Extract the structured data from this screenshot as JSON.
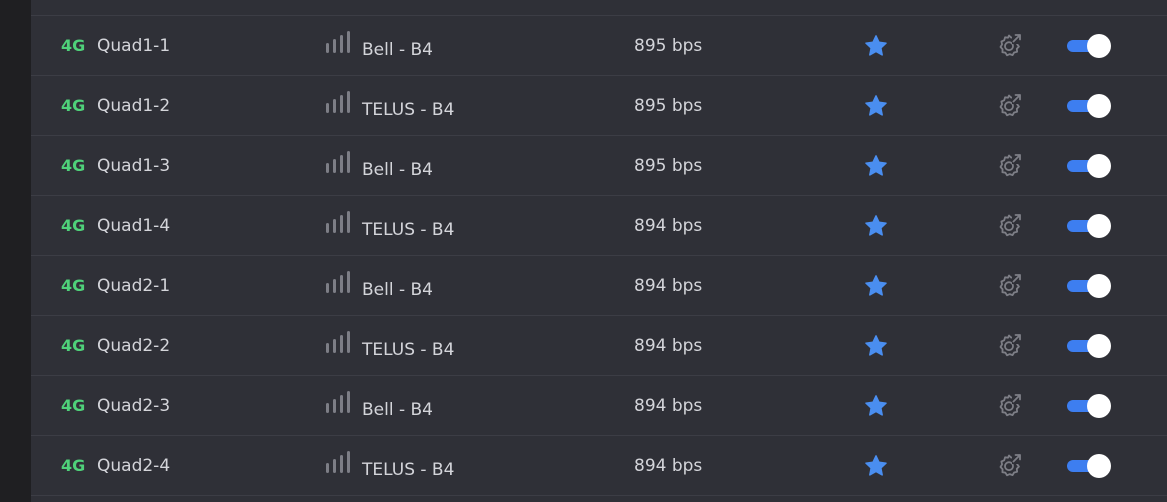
{
  "colors": {
    "tech_badge": "#4fd17a",
    "star": "#4a8ef0",
    "toggle_on": "#3d7ef0",
    "icon_muted": "#7d7e86",
    "text": "#d4d5da"
  },
  "icons": {
    "signal": "signal-bars-icon",
    "favorite": "star-icon",
    "settings": "gear-arrow-icon"
  },
  "modems": [
    {
      "tech": "4G",
      "name": "Quad1-1",
      "carrier": "Bell - B4",
      "rate": "895 bps",
      "favorite": true,
      "enabled": true
    },
    {
      "tech": "4G",
      "name": "Quad1-2",
      "carrier": "TELUS - B4",
      "rate": "895 bps",
      "favorite": true,
      "enabled": true
    },
    {
      "tech": "4G",
      "name": "Quad1-3",
      "carrier": "Bell - B4",
      "rate": "895 bps",
      "favorite": true,
      "enabled": true
    },
    {
      "tech": "4G",
      "name": "Quad1-4",
      "carrier": "TELUS - B4",
      "rate": "894 bps",
      "favorite": true,
      "enabled": true
    },
    {
      "tech": "4G",
      "name": "Quad2-1",
      "carrier": "Bell - B4",
      "rate": "894 bps",
      "favorite": true,
      "enabled": true
    },
    {
      "tech": "4G",
      "name": "Quad2-2",
      "carrier": "TELUS - B4",
      "rate": "894 bps",
      "favorite": true,
      "enabled": true
    },
    {
      "tech": "4G",
      "name": "Quad2-3",
      "carrier": "Bell - B4",
      "rate": "894 bps",
      "favorite": true,
      "enabled": true
    },
    {
      "tech": "4G",
      "name": "Quad2-4",
      "carrier": "TELUS - B4",
      "rate": "894 bps",
      "favorite": true,
      "enabled": true
    }
  ]
}
